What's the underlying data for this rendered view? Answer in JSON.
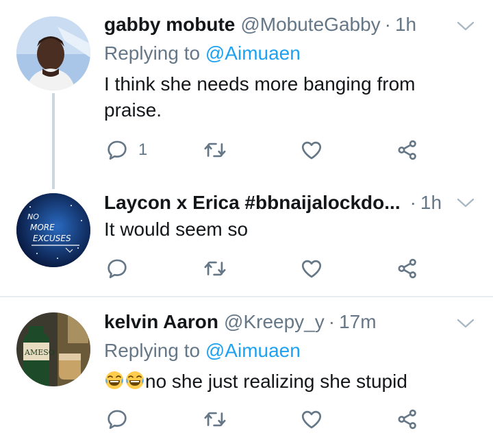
{
  "tweets": [
    {
      "name": "gabby mobute",
      "handle": "@MobuteGabby",
      "time": "1h",
      "replying_label": "Replying to",
      "replying_to": "@Aimuaen",
      "text": "I think she needs more banging from praise.",
      "reply_count": "1",
      "avatar": "man-portrait-avatar"
    },
    {
      "name": "Laycon x Erica #bbnaijalockdo...",
      "handle": "",
      "time": "1h",
      "text": "It would seem so",
      "reply_count": "",
      "avatar_text": [
        "NO",
        "MORE",
        "EXCUSES"
      ]
    },
    {
      "name": "kelvin Aaron",
      "handle": "@Kreepy_y",
      "time": "17m",
      "replying_label": "Replying to",
      "replying_to": "@Aimuaen",
      "emojis": [
        "face-with-tears-of-joy-icon",
        "face-with-tears-of-joy-icon"
      ],
      "text": "no she just realizing she stupid",
      "reply_count": "",
      "avatar_text": "AMESO"
    }
  ],
  "colors": {
    "text": "#14171a",
    "secondary": "#657786",
    "link": "#1da1f2",
    "divider": "#e6ecf0"
  }
}
